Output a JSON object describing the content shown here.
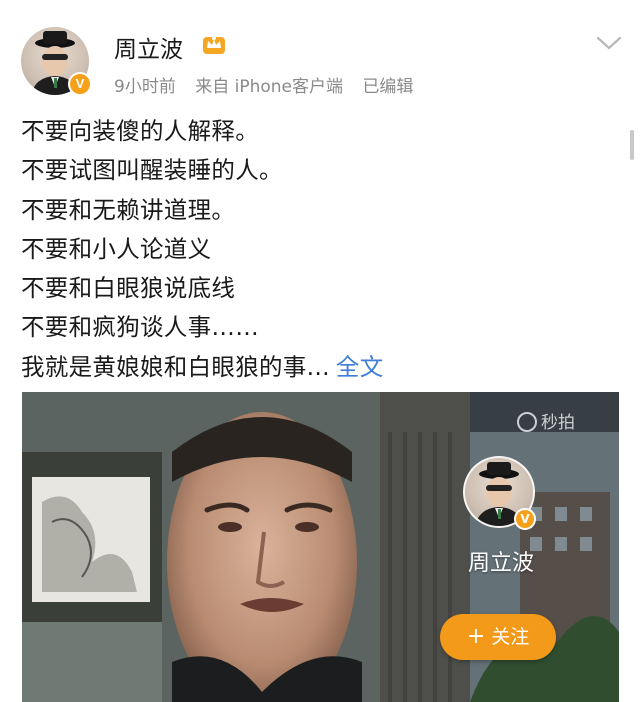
{
  "post": {
    "author": "周立波",
    "verified_badge": "V",
    "time": "9小时前",
    "source": "来自 iPhone客户端",
    "edited": "已编辑",
    "lines": [
      "不要向装傻的人解释。",
      "不要试图叫醒装睡的人。",
      "不要和无赖讲道理。",
      "不要和小人论道义",
      "不要和白眼狼说底线",
      "不要和疯狗谈人事……",
      "我就是黄娘娘和白眼狼的事..."
    ],
    "full_text_link": "全文"
  },
  "video": {
    "watermark": "秒拍",
    "overlay_name": "周立波",
    "overlay_badge": "V",
    "follow_label": "关注",
    "follow_plus": "+"
  },
  "colors": {
    "link": "#3f7ed6",
    "badge": "#f7a11a",
    "follow": "#f39a1a",
    "meta": "#8a8a8a"
  },
  "icons": [
    "avatar",
    "crown-icon",
    "chevron-down-icon",
    "play-icon",
    "plus-icon"
  ]
}
